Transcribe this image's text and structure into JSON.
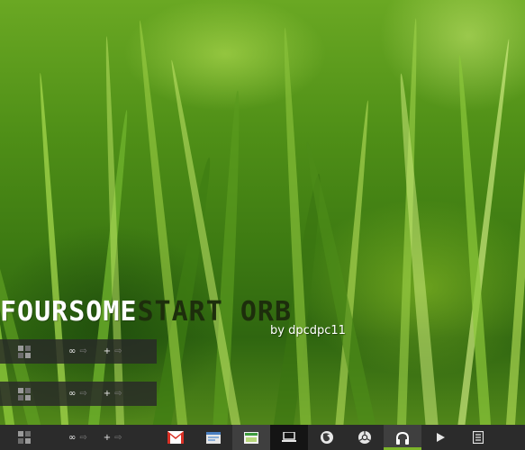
{
  "wallpaper": {
    "subject": "green grass blades",
    "accent_color": "#7cb52a"
  },
  "title": {
    "part1": "FOURSOME",
    "part2": "START ORB",
    "byline": "by dpcdpc11"
  },
  "preview_bars": [
    {
      "infinity": "∞",
      "plus": "+",
      "arrow": "⇨"
    },
    {
      "infinity": "∞",
      "plus": "+",
      "arrow": "⇨"
    }
  ],
  "taskbar": {
    "start_orb": {
      "icon": "start-orb-icon"
    },
    "infinity": "∞",
    "plus": "+",
    "arrow": "⇨",
    "apps": [
      {
        "name": "gmail",
        "icon": "gmail-icon"
      },
      {
        "name": "browser-window",
        "icon": "window-icon"
      },
      {
        "name": "image-viewer",
        "icon": "image-icon"
      },
      {
        "name": "my-computer",
        "icon": "laptop-icon"
      },
      {
        "name": "firefox",
        "icon": "firefox-icon"
      },
      {
        "name": "chrome",
        "icon": "chrome-icon"
      },
      {
        "name": "music-player",
        "icon": "headphones-icon"
      },
      {
        "name": "media-player",
        "icon": "play-icon"
      },
      {
        "name": "notes",
        "icon": "notepad-icon"
      }
    ]
  }
}
